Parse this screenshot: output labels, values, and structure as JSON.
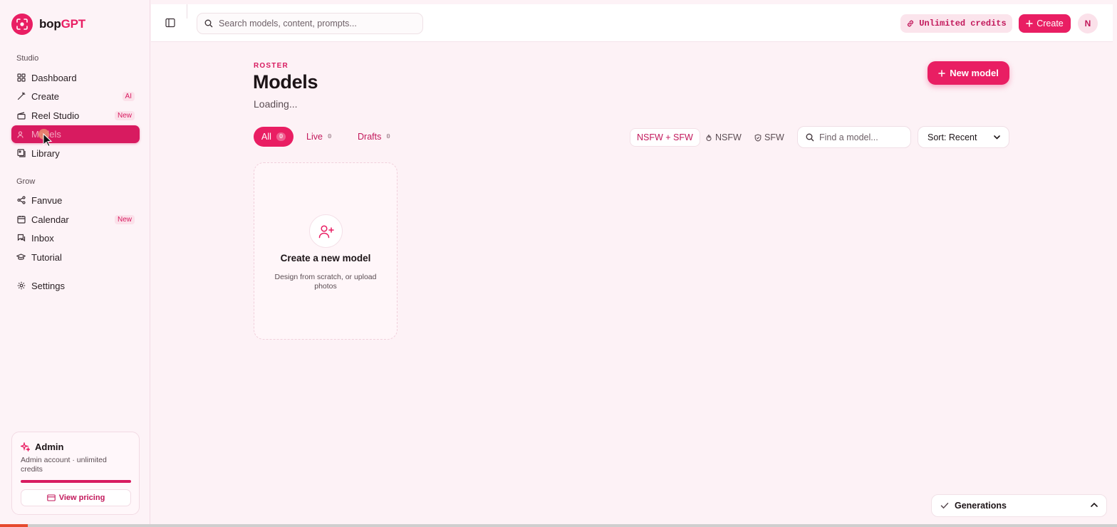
{
  "brand": {
    "name_prefix": "bop",
    "name_suffix": "GPT"
  },
  "sidebar": {
    "studio_label": "Studio",
    "grow_label": "Grow",
    "items": [
      {
        "label": "Dashboard",
        "icon": "dashboard-icon"
      },
      {
        "label": "Create",
        "icon": "wand-icon",
        "badge": "AI"
      },
      {
        "label": "Reel Studio",
        "icon": "clapper-icon",
        "badge": "New"
      },
      {
        "label": "Models",
        "icon": "users-icon",
        "active": true
      },
      {
        "label": "Library",
        "icon": "images-icon"
      },
      {
        "label": "Fanvue",
        "icon": "share-icon"
      },
      {
        "label": "Calendar",
        "icon": "calendar-icon",
        "badge": "New"
      },
      {
        "label": "Inbox",
        "icon": "chat-icon"
      },
      {
        "label": "Tutorial",
        "icon": "graduation-cap-icon"
      },
      {
        "label": "Settings",
        "icon": "gear-icon"
      }
    ],
    "admin": {
      "title": "Admin",
      "description": "Admin account · unlimited credits",
      "button": "View pricing"
    }
  },
  "topbar": {
    "search_placeholder": "Search models, content, prompts...",
    "credits": "Unlimited credits",
    "create": "Create",
    "avatar": "N"
  },
  "main": {
    "eyebrow": "ROSTER",
    "title": "Models",
    "subtitle": "Loading...",
    "new_model": "New model",
    "tabs": [
      {
        "label": "All",
        "count": "0",
        "active": true
      },
      {
        "label": "Live",
        "count": "0"
      },
      {
        "label": "Drafts",
        "count": "0"
      }
    ],
    "filters": [
      {
        "label": "NSFW + SFW",
        "active": true
      },
      {
        "label": "NSFW",
        "icon": "flame-icon"
      },
      {
        "label": "SFW",
        "icon": "shield-icon"
      }
    ],
    "find_placeholder": "Find a model...",
    "sort": "Sort: Recent",
    "create_card": {
      "title": "Create a new model",
      "description": "Design from scratch, or upload photos"
    }
  },
  "generations": {
    "label": "Generations"
  },
  "progress": {
    "fraction": 0.025
  },
  "colors": {
    "accent": "#e91e63",
    "background": "#fdf2f6"
  }
}
